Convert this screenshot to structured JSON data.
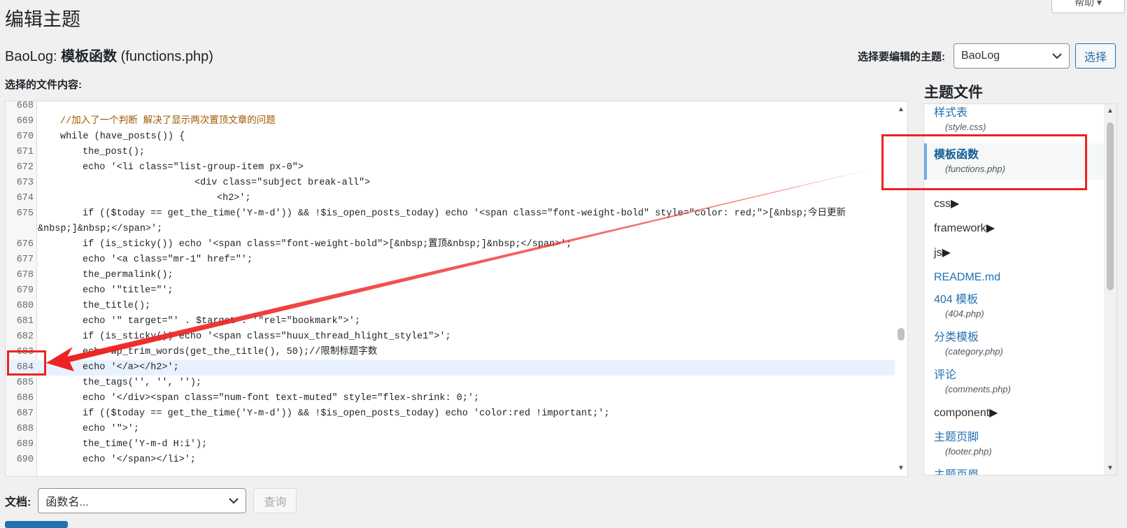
{
  "header": {
    "page_title": "编辑主题",
    "help_label": "帮助 ▾",
    "file_heading_theme": "BaoLog:",
    "file_heading_name": "模板函数",
    "file_heading_file": "(functions.php)"
  },
  "theme_picker": {
    "label": "选择要编辑的主题:",
    "selected": "BaoLog",
    "button": "选择"
  },
  "editor": {
    "label": "选择的文件内容:",
    "highlighted_line": 684,
    "lines": [
      {
        "n": "668",
        "code": ""
      },
      {
        "n": "669",
        "code": "//加入了一个判断 解决了显示两次置顶文章的问题"
      },
      {
        "n": "670",
        "code": "while (have_posts()) {"
      },
      {
        "n": "671",
        "code": "the_post();"
      },
      {
        "n": "672",
        "code": "echo '<li class=\"list-group-item px-0\">"
      },
      {
        "n": "673",
        "code": "<div class=\"subject break-all\">"
      },
      {
        "n": "674",
        "code": "<h2>';"
      },
      {
        "n": "675",
        "code": "if (($today == get_the_time('Y-m-d')) && !$is_open_posts_today) echo '<span class=\"font-weight-bold\" style=\"color: red;\">[&nbsp;今日更新"
      },
      {
        "n": "",
        "code": "&nbsp;]&nbsp;</span>';"
      },
      {
        "n": "676",
        "code": "if (is_sticky()) echo '<span class=\"font-weight-bold\">[&nbsp;置顶&nbsp;]&nbsp;</span>';"
      },
      {
        "n": "677",
        "code": "echo '<a class=\"mr-1\" href=\"';"
      },
      {
        "n": "678",
        "code": "the_permalink();"
      },
      {
        "n": "679",
        "code": "echo '\"title=\"';"
      },
      {
        "n": "680",
        "code": "the_title();"
      },
      {
        "n": "681",
        "code": "echo '\" target=\"' . $target . '\"rel=\"bookmark\">';"
      },
      {
        "n": "682",
        "code": "if (is_sticky()) echo '<span class=\"huux_thread_hlight_style1\">';"
      },
      {
        "n": "683",
        "code": "echo wp_trim_words(get_the_title(), 50);//限制标题字数"
      },
      {
        "n": "684",
        "code": "echo '</a></h2>';"
      },
      {
        "n": "685",
        "code": "the_tags('', '', '');"
      },
      {
        "n": "686",
        "code": "echo '</div><span class=\"num-font text-muted\" style=\"flex-shrink: 0;';"
      },
      {
        "n": "687",
        "code": "if (($today == get_the_time('Y-m-d')) && !$is_open_posts_today) echo 'color:red !important;';"
      },
      {
        "n": "688",
        "code": "echo '\">';"
      },
      {
        "n": "689",
        "code": "the_time('Y-m-d H:i');"
      },
      {
        "n": "690",
        "code": "echo '</span></li>';"
      }
    ]
  },
  "sidebar": {
    "title": "主题文件",
    "items": [
      {
        "type": "file",
        "label": "样式表",
        "file": "(style.css)"
      },
      {
        "type": "file",
        "label": "模板函数",
        "file": "(functions.php)",
        "current": true
      },
      {
        "type": "folder",
        "label": "css"
      },
      {
        "type": "folder",
        "label": "framework"
      },
      {
        "type": "folder",
        "label": "js"
      },
      {
        "type": "link",
        "label": "README.md"
      },
      {
        "type": "file",
        "label": "404 模板",
        "file": "(404.php)"
      },
      {
        "type": "file",
        "label": "分类模板",
        "file": "(category.php)"
      },
      {
        "type": "file",
        "label": "评论",
        "file": "(comments.php)"
      },
      {
        "type": "folder",
        "label": "component"
      },
      {
        "type": "file",
        "label": "主题页脚",
        "file": "(footer.php)"
      },
      {
        "type": "link",
        "label": "主题页眉"
      }
    ]
  },
  "docs": {
    "label": "文档:",
    "placeholder": "函数名...",
    "button": "查询"
  },
  "colors": {
    "annotation": "#e22222",
    "link": "#2271b1"
  }
}
